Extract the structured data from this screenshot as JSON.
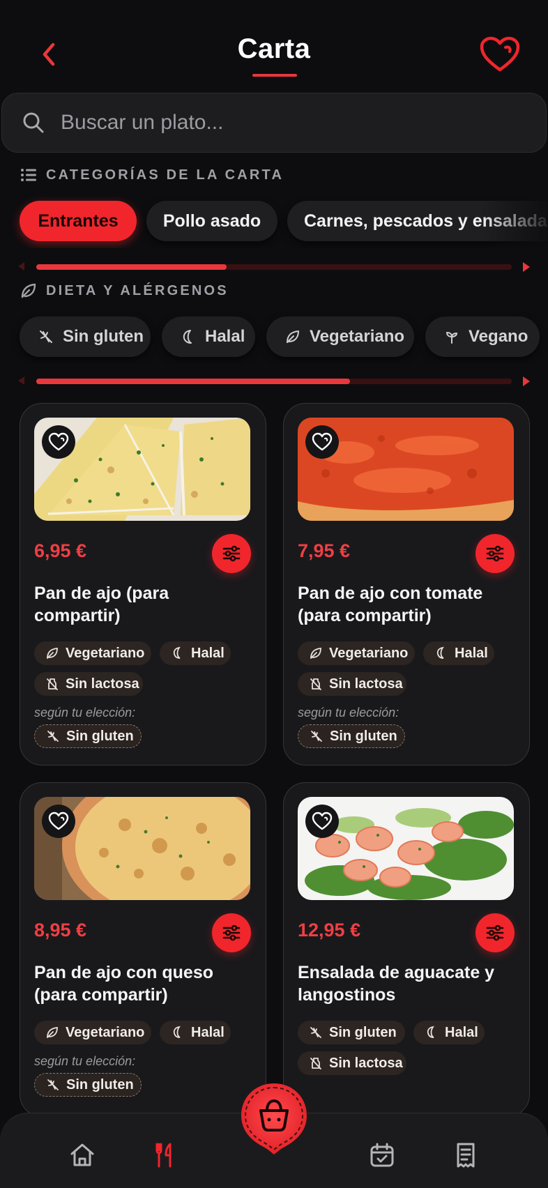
{
  "header": {
    "title": "Carta"
  },
  "search": {
    "placeholder": "Buscar un plato..."
  },
  "categories": {
    "label": "CATEGORÍAS DE LA CARTA",
    "items": [
      "Entrantes",
      "Pollo asado",
      "Carnes, pescados y ensaladas"
    ],
    "active": "Entrantes",
    "scroll_progress": 0.4
  },
  "diet": {
    "label": "DIETA Y ALÉRGENOS",
    "items": [
      "Sin gluten",
      "Halal",
      "Vegetariano",
      "Vegano"
    ],
    "scroll_progress": 0.66
  },
  "products": [
    {
      "price": "6,95 €",
      "name": "Pan de ajo (para compartir)",
      "tags": [
        "Vegetariano",
        "Halal",
        "Sin lactosa"
      ],
      "choice_label": "según tu elección:",
      "choice_tag": "Sin gluten"
    },
    {
      "price": "7,95 €",
      "name": "Pan de ajo con tomate (para compartir)",
      "tags": [
        "Vegetariano",
        "Halal",
        "Sin lactosa"
      ],
      "choice_label": "según tu elección:",
      "choice_tag": "Sin gluten"
    },
    {
      "price": "8,95 €",
      "name": "Pan de ajo con queso (para compartir)",
      "tags": [
        "Vegetariano",
        "Halal"
      ],
      "choice_label": "según tu elección:",
      "choice_tag": "Sin gluten"
    },
    {
      "price": "12,95 €",
      "name": "Ensalada de aguacate y langostinos",
      "tags": [
        "Sin gluten",
        "Halal",
        "Sin lactosa"
      ]
    }
  ],
  "nav": {
    "items": [
      "home-icon",
      "cutlery-icon",
      "basket-icon",
      "calendar-check-icon",
      "receipt-icon"
    ],
    "active": "cutlery-icon"
  },
  "colors": {
    "accent": "#f0262c",
    "background": "#0d0d0f",
    "card": "#19191c",
    "tag": "#2c2521"
  }
}
